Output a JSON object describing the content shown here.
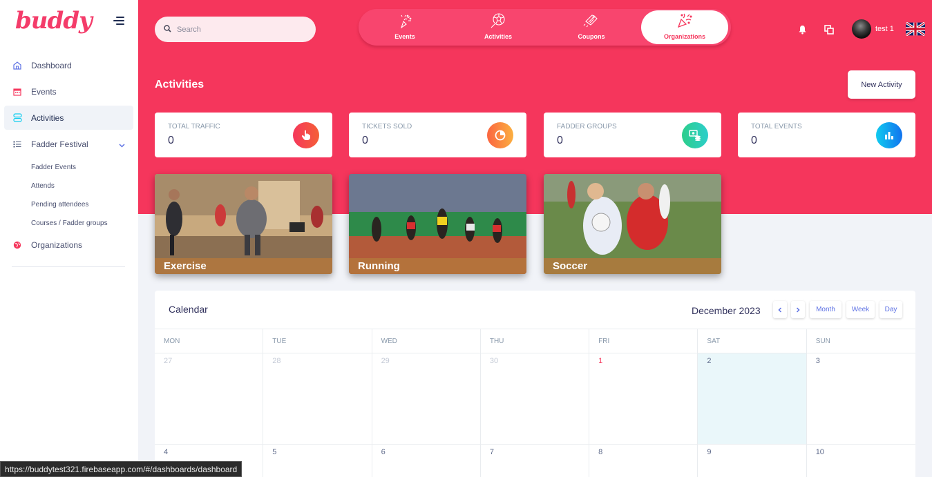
{
  "brand": {
    "logo": "buddy",
    "accent": "#f5365c"
  },
  "sidebar": {
    "items": [
      {
        "label": "Dashboard",
        "icon": "home-icon"
      },
      {
        "label": "Events",
        "icon": "calendar-icon"
      },
      {
        "label": "Activities",
        "icon": "activities-icon",
        "active": true
      },
      {
        "label": "Fadder Festival",
        "icon": "list-icon",
        "expanded": true
      },
      {
        "label": "Organizations",
        "icon": "globe-icon"
      }
    ],
    "sub_items": [
      "Fadder Events",
      "Attends",
      "Pending attendees",
      "Courses / Fadder groups"
    ]
  },
  "search": {
    "placeholder": "Search"
  },
  "topnav": {
    "tabs": [
      {
        "label": "Events",
        "icon": "party-icon"
      },
      {
        "label": "Activities",
        "icon": "soccer-ball-icon"
      },
      {
        "label": "Coupons",
        "icon": "coupon-icon"
      },
      {
        "label": "Organizations",
        "icon": "confetti-icon",
        "active": true
      }
    ]
  },
  "user": {
    "name": "test 1",
    "language_flag": "uk-flag-icon"
  },
  "page": {
    "title": "Activities",
    "new_button": "New Activity"
  },
  "stats": [
    {
      "label": "TOTAL TRAFFIC",
      "value": "0",
      "color": "#f5365c",
      "icon": "hand-pointer-icon"
    },
    {
      "label": "TICKETS SOLD",
      "value": "0",
      "color": "#fb6340",
      "icon": "pie-chart-icon"
    },
    {
      "label": "FADDER GROUPS",
      "value": "0",
      "color": "#2dce89",
      "icon": "money-coins-icon"
    },
    {
      "label": "TOTAL EVENTS",
      "value": "0",
      "color": "#11cdef",
      "icon": "bar-chart-icon"
    }
  ],
  "activity_cards": [
    {
      "label": "Exercise"
    },
    {
      "label": "Running"
    },
    {
      "label": "Soccer"
    }
  ],
  "calendar": {
    "title": "Calendar",
    "month": "December 2023",
    "buttons": [
      "Month",
      "Week",
      "Day"
    ],
    "days_of_week": [
      "MON",
      "TUE",
      "WED",
      "THU",
      "FRI",
      "SAT",
      "SUN"
    ],
    "weeks": [
      [
        "27",
        "28",
        "29",
        "30",
        "1",
        "2",
        "3"
      ],
      [
        "4",
        "5",
        "6",
        "7",
        "8",
        "9",
        "10"
      ]
    ]
  },
  "status_bar": {
    "url": "https://buddytest321.firebaseapp.com/#/dashboards/dashboard"
  }
}
